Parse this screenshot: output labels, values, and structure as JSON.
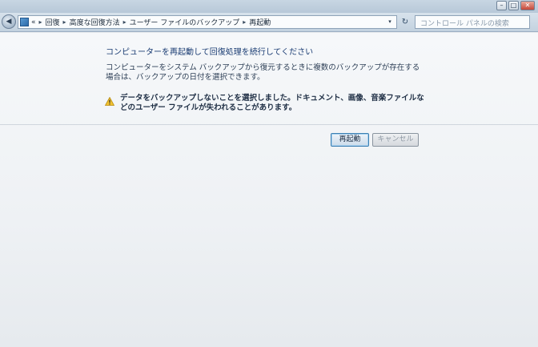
{
  "window": {
    "controls": {
      "minimize": "–",
      "maximize": "□",
      "close": "✕"
    }
  },
  "addressbar": {
    "back_icon": "back-arrow-icon",
    "overflow": "«",
    "crumbs": [
      "回復",
      "高度な回復方法",
      "ユーザー ファイルのバックアップ",
      "再起動"
    ],
    "separator": "▸",
    "dropdown": "▾",
    "refresh": "↻",
    "search_placeholder": "コントロール パネルの検索"
  },
  "main": {
    "heading": "コンピューターを再起動して回復処理を続行してください",
    "description": "コンピューターをシステム バックアップから復元するときに複数のバックアップが存在する場合は、バックアップの日付を選択できます。",
    "warning_icon": "warning-icon",
    "warning_text": "データをバックアップしないことを選択しました。ドキュメント、画像、音楽ファイルなどのユーザー ファイルが失われることがあります。",
    "restart_button": "再起動",
    "cancel_button": "キャンセル"
  },
  "colors": {
    "heading": "#1a3c73",
    "accent_border": "#3c7fb1",
    "warning_yellow": "#f2c230"
  }
}
